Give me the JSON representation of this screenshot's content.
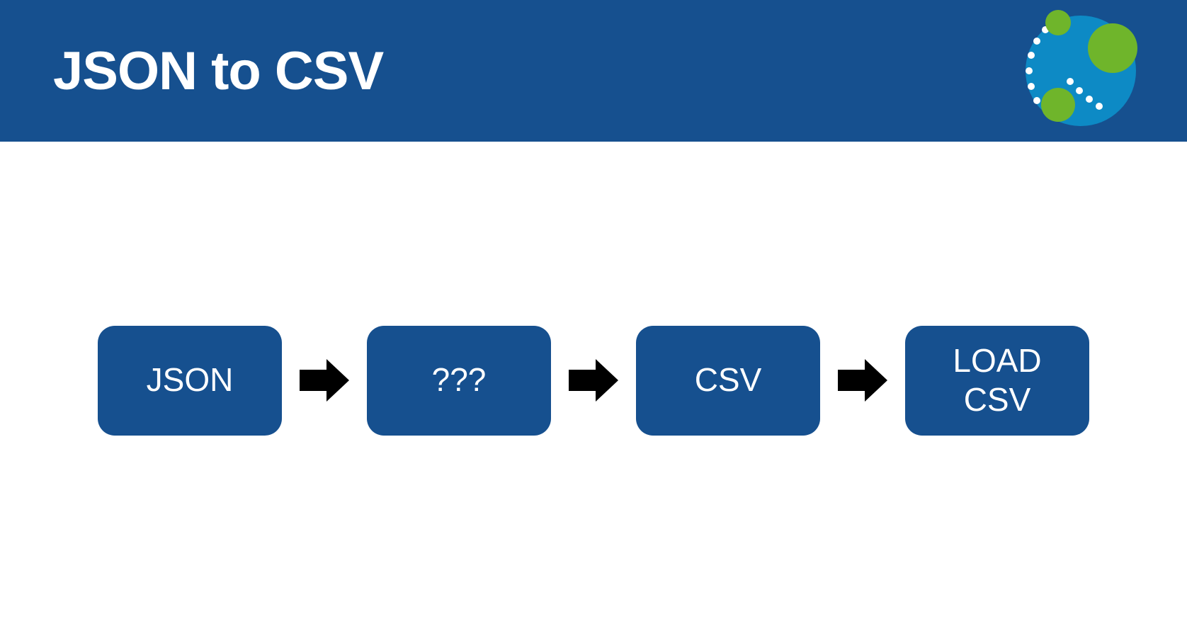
{
  "header": {
    "title": "JSON to CSV"
  },
  "diagram": {
    "boxes": [
      {
        "label": "JSON"
      },
      {
        "label": "???"
      },
      {
        "label": "CSV"
      },
      {
        "label": "LOAD CSV"
      }
    ]
  },
  "colors": {
    "headerBg": "#16508f",
    "boxBg": "#16508f",
    "text": "#ffffff",
    "arrow": "#000000",
    "logoGreen": "#6fb52b",
    "logoBlue": "#0d8ac5"
  }
}
